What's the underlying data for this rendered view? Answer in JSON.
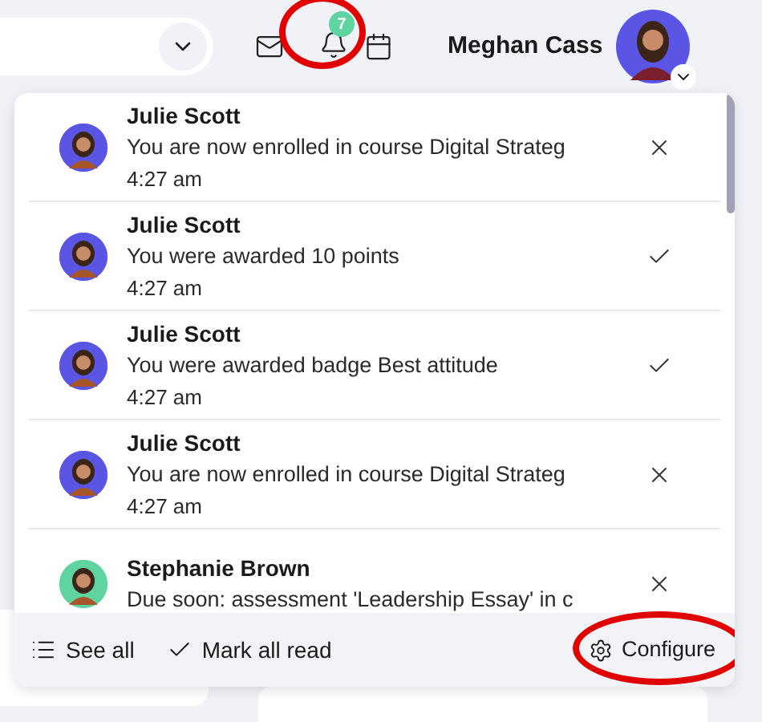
{
  "header": {
    "user_name": "Meghan Cass",
    "notification_count": "7"
  },
  "notifications": [
    {
      "sender": "Julie Scott",
      "message": "You are now enrolled in course Digital Strateg",
      "time": "4:27 am",
      "kind": "close",
      "color": "#5b55e6"
    },
    {
      "sender": "Julie Scott",
      "message": "You were awarded 10 points",
      "time": "4:27 am",
      "kind": "check",
      "color": "#5b55e6"
    },
    {
      "sender": "Julie Scott",
      "message": "You were awarded badge Best attitude",
      "time": "4:27 am",
      "kind": "check",
      "color": "#5b55e6"
    },
    {
      "sender": "Julie Scott",
      "message": "You are now enrolled in course Digital Strateg",
      "time": "4:27 am",
      "kind": "close",
      "color": "#5b55e6"
    },
    {
      "sender": "Stephanie Brown",
      "message": "Due soon: assessment 'Leadership Essay' in c",
      "kind": "close",
      "color": "#5fd3a0"
    }
  ],
  "footer": {
    "see_all": "See all",
    "mark_all_read": "Mark all read",
    "configure": "Configure"
  }
}
